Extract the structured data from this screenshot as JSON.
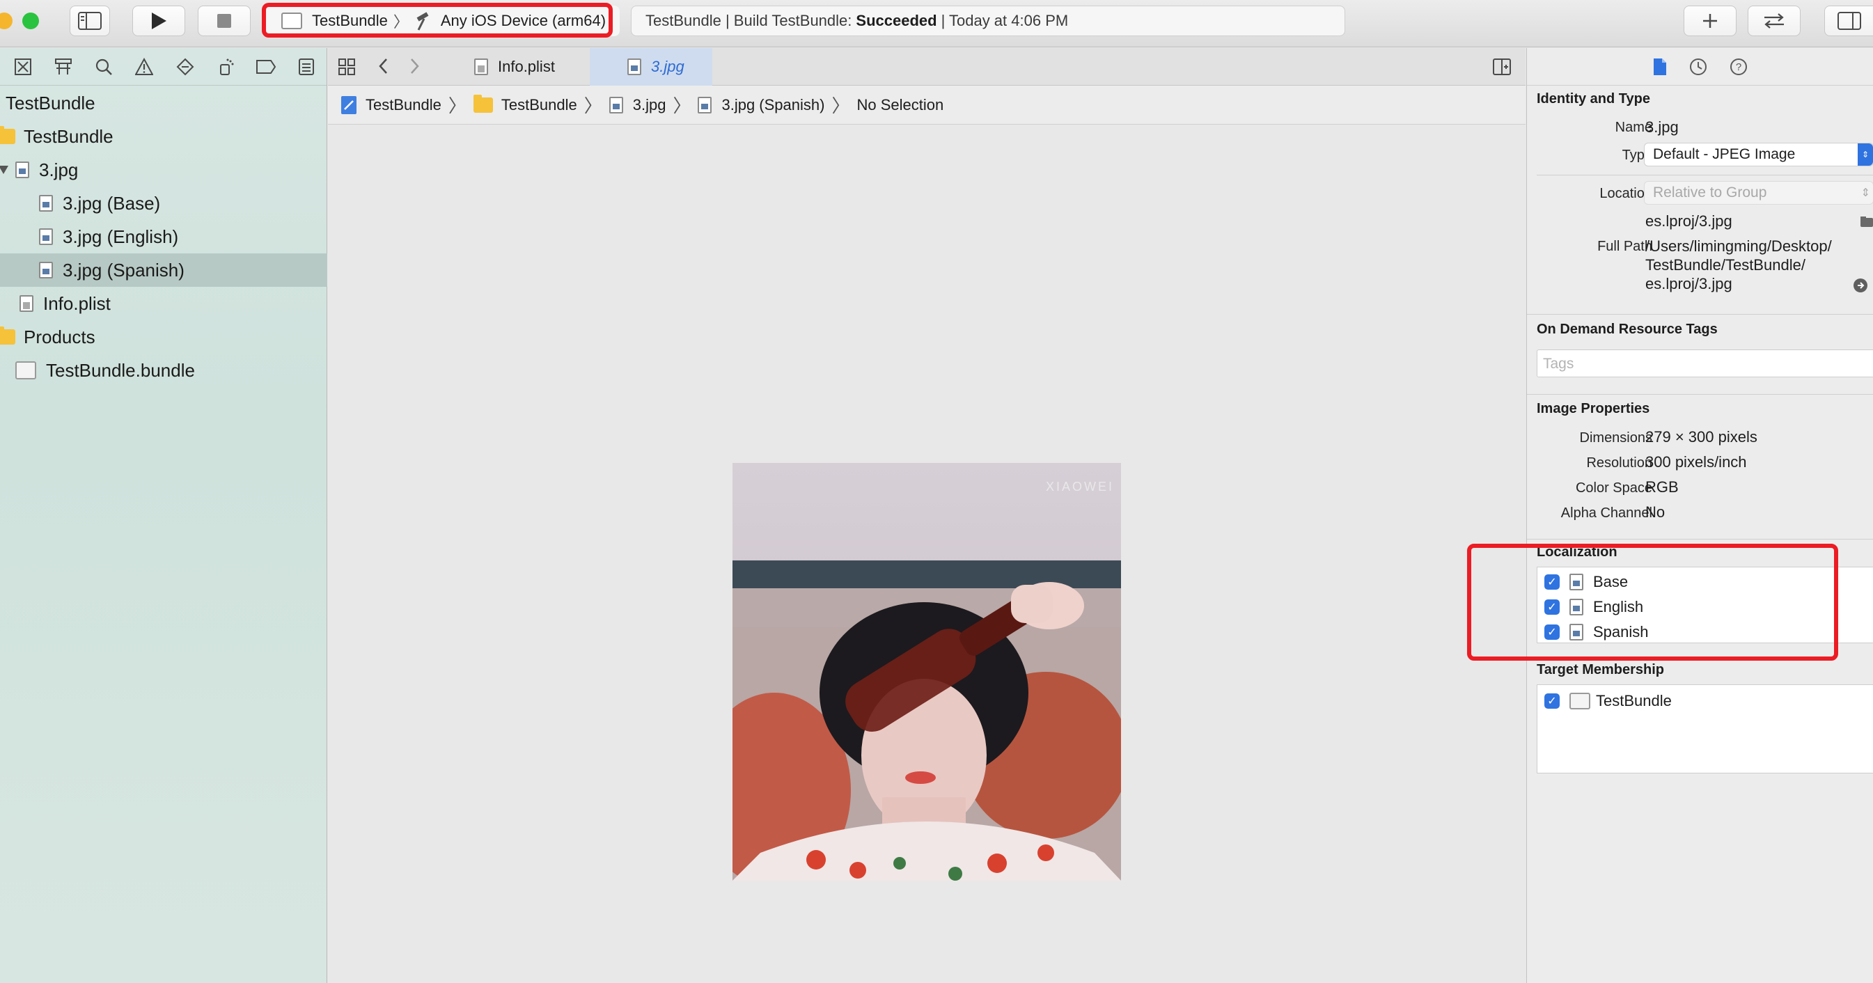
{
  "toolbar": {
    "scheme_target": "TestBundle",
    "scheme_device": "Any iOS Device (arm64)",
    "activity_prefix": "TestBundle | Build TestBundle:",
    "activity_status": "Succeeded",
    "activity_suffix": "| Today at 4:06 PM"
  },
  "navigator": {
    "items": [
      {
        "label": "TestBundle"
      },
      {
        "label": "TestBundle"
      },
      {
        "label": "3.jpg"
      },
      {
        "label": "3.jpg (Base)"
      },
      {
        "label": "3.jpg (English)"
      },
      {
        "label": "3.jpg (Spanish)"
      },
      {
        "label": "Info.plist"
      },
      {
        "label": "Products"
      },
      {
        "label": "TestBundle.bundle"
      }
    ]
  },
  "editor": {
    "tabs": [
      {
        "label": "Info.plist"
      },
      {
        "label": "3.jpg"
      }
    ],
    "jumpbar": [
      "TestBundle",
      "TestBundle",
      "3.jpg",
      "3.jpg (Spanish)",
      "No Selection"
    ],
    "watermark": "XIAOWEI"
  },
  "inspector": {
    "identity": {
      "title": "Identity and Type",
      "name_label": "Name",
      "name_value": "3.jpg",
      "type_label": "Type",
      "type_value": "Default - JPEG Image",
      "location_label": "Location",
      "location_value": "Relative to Group",
      "location_path": "es.lproj/3.jpg",
      "fullpath_label": "Full Path",
      "fullpath_line1": "/Users/limingming/Desktop/",
      "fullpath_line2": "TestBundle/TestBundle/",
      "fullpath_line3": "es.lproj/3.jpg"
    },
    "tags": {
      "title": "On Demand Resource Tags",
      "placeholder": "Tags"
    },
    "image": {
      "title": "Image Properties",
      "dimensions_label": "Dimensions",
      "dimensions_value": "279 × 300 pixels",
      "resolution_label": "Resolution",
      "resolution_value": "300 pixels/inch",
      "colorspace_label": "Color Space",
      "colorspace_value": "RGB",
      "alpha_label": "Alpha Channel",
      "alpha_value": "No"
    },
    "localization": {
      "title": "Localization",
      "items": [
        {
          "label": "Base",
          "checked": true
        },
        {
          "label": "English",
          "checked": true
        },
        {
          "label": "Spanish",
          "checked": true
        }
      ]
    },
    "membership": {
      "title": "Target Membership",
      "items": [
        {
          "label": "TestBundle",
          "checked": true
        }
      ]
    }
  },
  "colors": {
    "accent": "#2f73e0",
    "highlight_box": "#ec1c24",
    "navigator_bg": "#d7e6e2"
  }
}
